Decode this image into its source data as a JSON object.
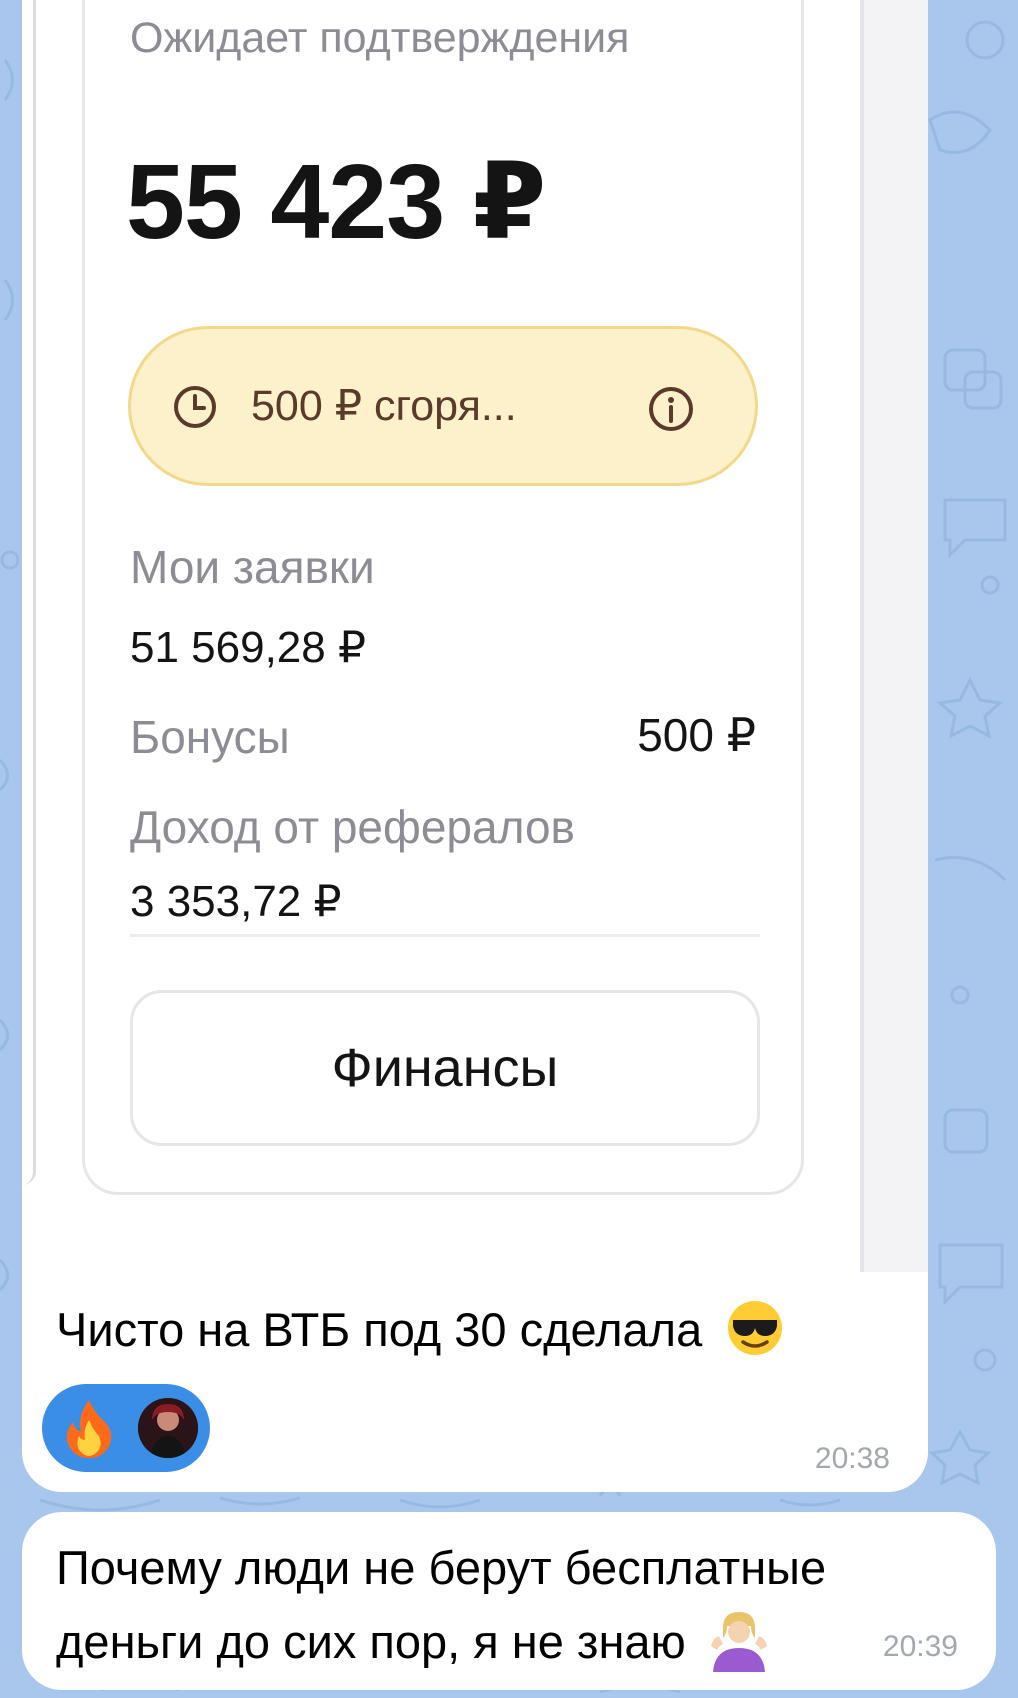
{
  "card": {
    "pending_label": "Ожидает подтверждения",
    "amount": "55 423 ₽",
    "promo_text": "500 ₽ сгоря...",
    "applications_label": "Мои заявки",
    "applications_value": "51 569,28 ₽",
    "bonus_label": "Бонусы",
    "bonus_value": "500 ₽",
    "referral_label": "Доход от рефералов",
    "referral_value": "3 353,72 ₽",
    "finance_button": "Финансы"
  },
  "messages": [
    {
      "text": "Чисто на ВТБ под 30 сделала",
      "emoji": "smiling-face-with-sunglasses",
      "time": "20:38",
      "reaction": {
        "emoji": "fire",
        "reactor_avatar": "avatar"
      }
    },
    {
      "line1": "Почему люди не берут бесплатные",
      "line2": "деньги до сих пор, я не знаю",
      "emoji": "person-shrugging",
      "time": "20:39"
    }
  ],
  "colors": {
    "wallpaper": "#a9c7ec",
    "promo_bg": "#fdf1cc",
    "reaction_bg": "#3a8ee6"
  }
}
